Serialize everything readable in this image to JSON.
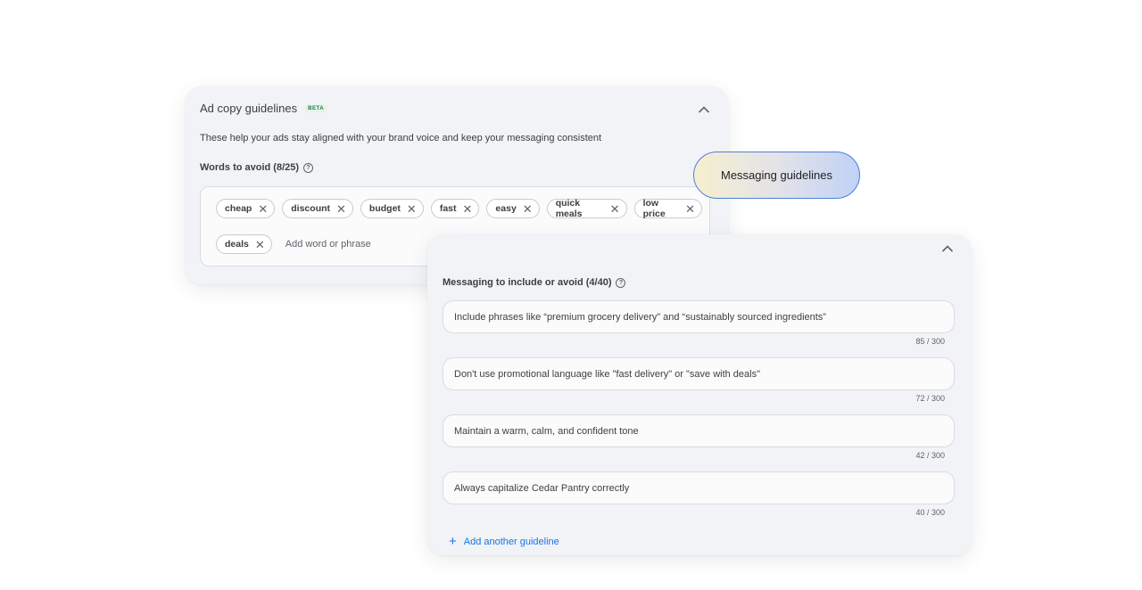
{
  "ad_copy_card": {
    "title": "Ad copy guidelines",
    "badge": "BETA",
    "description": "These help your ads stay aligned with your brand voice and keep your messaging consistent",
    "words_label": "Words to avoid (8/25)",
    "chips": [
      "cheap",
      "discount",
      "budget",
      "fast",
      "easy",
      "quick meals",
      "low price",
      "deals"
    ],
    "input_placeholder": "Add word or phrase"
  },
  "callout": {
    "label": "Messaging guidelines"
  },
  "messaging_card": {
    "section_label": "Messaging to include or avoid (4/40)",
    "guidelines": [
      {
        "text": "Include phrases like “premium grocery delivery” and “sustainably sourced ingredients”",
        "count": "85 / 300"
      },
      {
        "text": "Don't use promotional language like \"fast delivery\" or \"save with deals\"",
        "count": "72 / 300"
      },
      {
        "text": "Maintain a warm, calm, and confident tone",
        "count": "42 / 300"
      },
      {
        "text": "Always capitalize Cedar Pantry correctly",
        "count": "40 / 300"
      }
    ],
    "add_label": "Add another guideline"
  },
  "icons": {
    "collapse": "chevron-up-icon",
    "help": "help-circle-icon",
    "remove": "close-icon",
    "add": "plus-icon"
  },
  "colors": {
    "accent": "#1a73e8",
    "beta": "#188038",
    "card_bg": "#f1f3f6"
  }
}
